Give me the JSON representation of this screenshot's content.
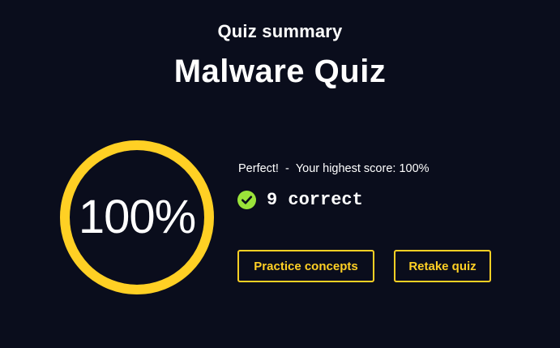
{
  "header": {
    "subtitle": "Quiz summary",
    "title": "Malware Quiz"
  },
  "score": {
    "percent_text": "100%",
    "fraction": 1.0,
    "ring_color": "#ffd024",
    "ring_track_color": "#ffd024"
  },
  "result": {
    "status": "Perfect!",
    "separator": "-",
    "highest_score": "Your highest score: 100%",
    "correct_text": "9 correct",
    "check_color": "#9be43a"
  },
  "actions": {
    "practice_label": "Practice concepts",
    "retake_label": "Retake quiz",
    "accent": "#ffd024"
  },
  "colors": {
    "background": "#0a0d1c",
    "text": "#ffffff"
  }
}
